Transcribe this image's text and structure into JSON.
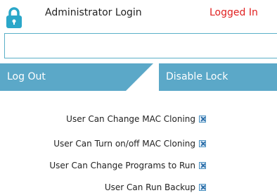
{
  "header": {
    "title": "Administrator Login",
    "status": "Logged In",
    "status_color": "#e02020",
    "icon": "lock-icon"
  },
  "password_input": {
    "value": "",
    "placeholder": ""
  },
  "buttons": {
    "logout": "Log Out",
    "disable_lock": "Disable Lock",
    "color": "#5ba8c8"
  },
  "permissions": [
    {
      "label": "User Can Change MAC Cloning",
      "checked": true
    },
    {
      "label": "User Can Turn on/off MAC Cloning",
      "checked": true
    },
    {
      "label": "User Can Change Programs to Run",
      "checked": true
    },
    {
      "label": "User Can Run Backup",
      "checked": true
    }
  ]
}
